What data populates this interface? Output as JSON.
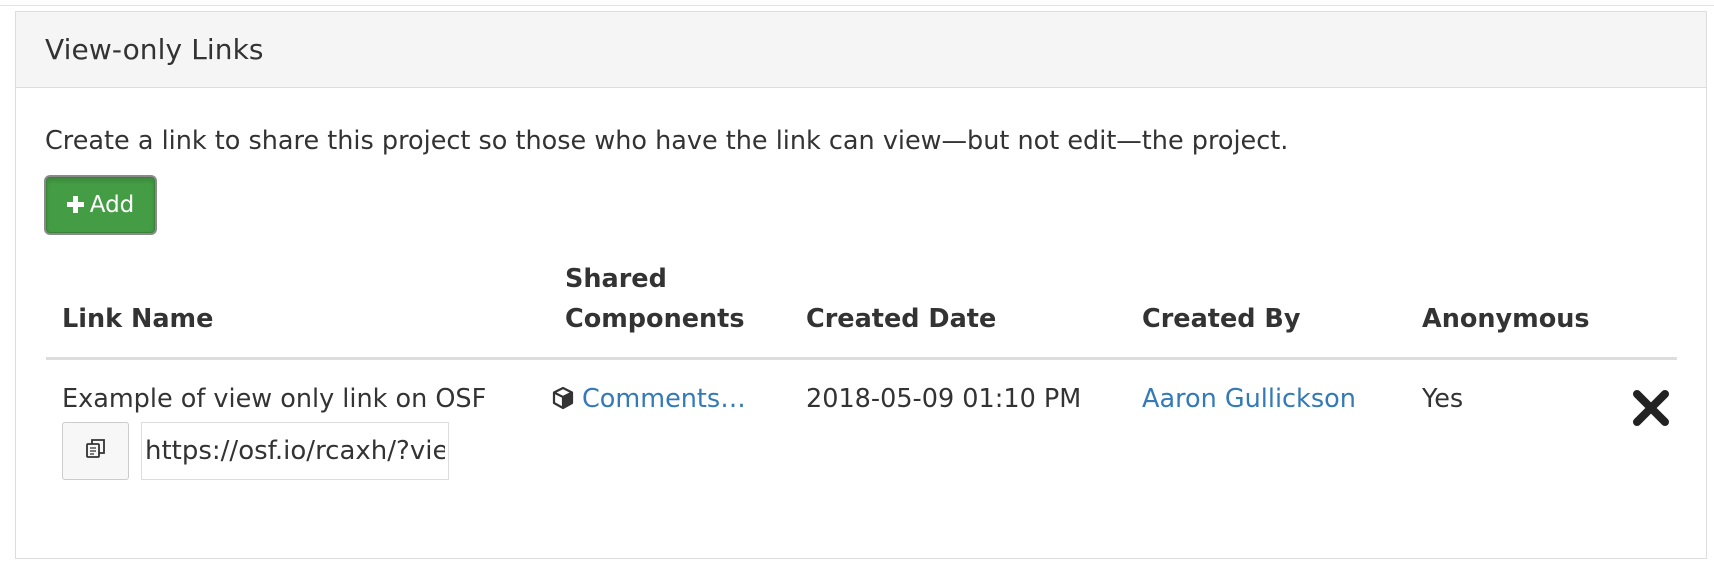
{
  "panel": {
    "title": "View-only Links",
    "description": "Create a link to share this project so those who have the link can view—but not edit—the project.",
    "add_button_label": "Add",
    "add_icon": "plus-icon"
  },
  "table": {
    "headers": {
      "link_name": "Link Name",
      "shared_components_line1": "Shared",
      "shared_components_line2": "Components",
      "created_date": "Created Date",
      "created_by": "Created By",
      "anonymous": "Anonymous"
    },
    "rows": [
      {
        "link_name": "Example of view only link on OSF",
        "url": "https://osf.io/rcaxh/?view_only=",
        "copy_icon": "copy-icon",
        "component_icon": "cube-icon",
        "component": "Comments…",
        "created_date": "2018-05-09 01:10 PM",
        "created_by": "Aaron Gullickson",
        "anonymous": "Yes",
        "delete_icon": "close-icon"
      }
    ]
  },
  "colors": {
    "link": "#337ab7",
    "add_button": "#449d44",
    "panel_heading_bg": "#f5f5f5"
  }
}
